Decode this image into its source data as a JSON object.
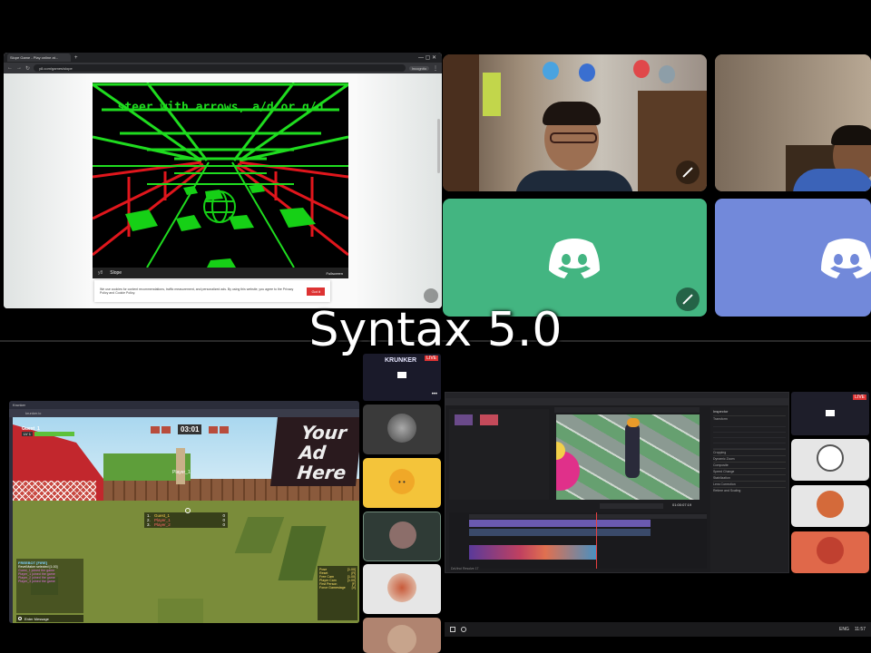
{
  "overlay_title": "Syntax 5.0",
  "browser": {
    "tab_title": "Slope Game - Play online at...",
    "url": "y8.com/games/slope",
    "profile_label": "Incognito",
    "game": {
      "instruction": "steer with arrows, a/d or q/d",
      "footer_brand": "Slope",
      "footer_right": "Fullscreen"
    },
    "cookie_banner": {
      "text": "We use cookies for content recommendations, traffic measurement, and personalized ads. By using this website, you agree to the Privacy Policy and Cookie Policy.",
      "button": "Got it"
    }
  },
  "discord_call": {
    "brand_color_green": "#43b581",
    "brand_color_blurple": "#7289da"
  },
  "krunker": {
    "tab_title": "Krunker",
    "url": "krunker.io",
    "timer": "03:01",
    "player_name": "Guest_1",
    "player_level": "LV 1",
    "billboard": "Your Ad Here",
    "floating_name": "Player_1",
    "scoreboard": [
      {
        "rank": "1.",
        "name": "Guest_1",
        "score": "0"
      },
      {
        "rank": "2.",
        "name": "Player_1",
        "score": "0"
      },
      {
        "rank": "3.",
        "name": "Player_2",
        "score": "0"
      }
    ],
    "chat_header": "FREEBOT [FIRE]",
    "chat_lines": [
      "RevelMaker selected [1.00]",
      "Guest_1 joined the game",
      "Player_1 joined the game",
      "Player_2 joined the game",
      "Player_3 joined the game"
    ],
    "chat_input": "Enter Message",
    "settings": [
      {
        "label": "Pose",
        "value": "[1.00]"
      },
      {
        "label": "Reset",
        "value": "[R]"
      },
      {
        "label": "Free Cam",
        "value": "[1.00]"
      },
      {
        "label": "Player Cam",
        "value": "[1.00]"
      },
      {
        "label": "First Person",
        "value": "[F]"
      },
      {
        "label": "Force Gamestage",
        "value": "[V]"
      }
    ]
  },
  "stream_preview_left": {
    "live_badge": "LIVE",
    "brand": "KRUNKER"
  },
  "stream_preview_right": {
    "live_badge": "LIVE"
  },
  "editor": {
    "app_title": "DaVinci Resolve 17",
    "inspector_title": "Inspector",
    "panels": [
      "Transform",
      "Cropping",
      "Dynamic Zoom",
      "Composite",
      "Speed Change",
      "Stabilization",
      "Lens Correction",
      "Retime and Scaling"
    ],
    "timecode": "01:00:07:19",
    "clock": "11:57",
    "lang": "ENG"
  }
}
